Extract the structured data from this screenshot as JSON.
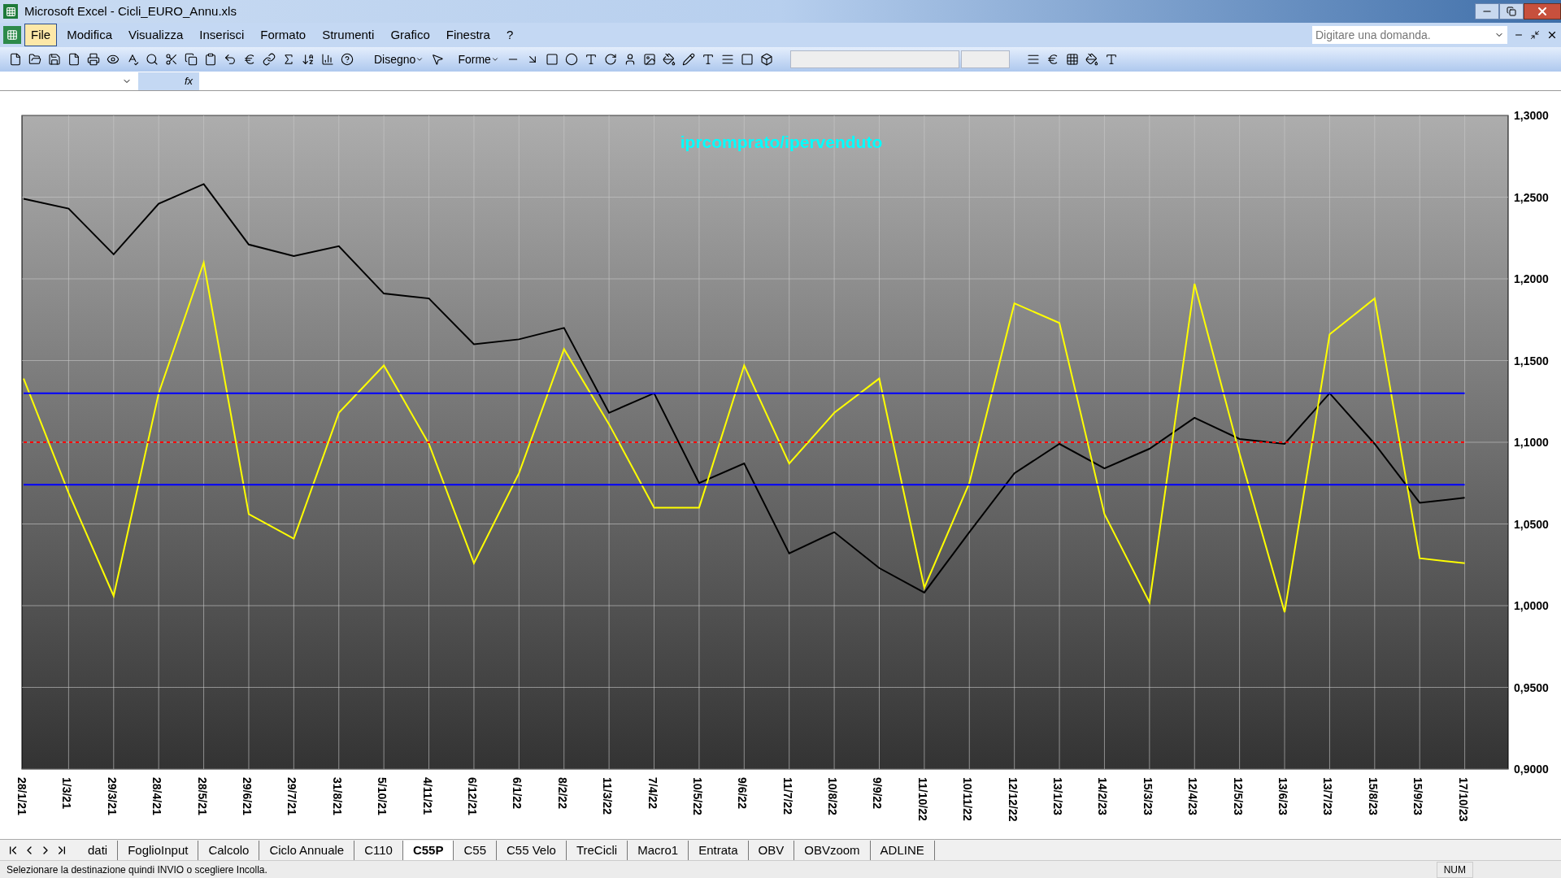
{
  "window": {
    "title": "Microsoft Excel - Cicli_EURO_Annu.xls"
  },
  "menu": [
    {
      "label": "File",
      "selected": true
    },
    {
      "label": "Modifica",
      "selected": false
    },
    {
      "label": "Visualizza",
      "selected": false
    },
    {
      "label": "Inserisci",
      "selected": false
    },
    {
      "label": "Formato",
      "selected": false
    },
    {
      "label": "Strumenti",
      "selected": false
    },
    {
      "label": "Grafico",
      "selected": false
    },
    {
      "label": "Finestra",
      "selected": false
    },
    {
      "label": "?",
      "selected": false
    }
  ],
  "help_search": {
    "placeholder": "Digitare una domanda."
  },
  "toolbar": {
    "drawing_menus": [
      "Disegno",
      "Forme"
    ]
  },
  "formula_bar": {
    "function_label": "fx"
  },
  "chart": {
    "chart_data": {
      "type": "line",
      "title": "iprcomprato/ipervenduto",
      "categories": [
        "28/1/21",
        "1/3/21",
        "29/3/21",
        "28/4/21",
        "28/5/21",
        "29/6/21",
        "29/7/21",
        "31/8/21",
        "5/10/21",
        "4/11/21",
        "6/12/21",
        "6/1/22",
        "8/2/22",
        "11/3/22",
        "7/4/22",
        "10/5/22",
        "9/6/22",
        "11/7/22",
        "10/8/22",
        "9/9/22",
        "11/10/22",
        "10/11/22",
        "12/12/22",
        "13/1/23",
        "14/2/23",
        "15/3/23",
        "12/4/23",
        "12/5/23",
        "13/6/23",
        "13/7/23",
        "15/8/23",
        "15/9/23",
        "17/10/23"
      ],
      "ylim": [
        0.9,
        1.3
      ],
      "grid": true,
      "yticks": [
        {
          "value": 0.9,
          "label": "0,9000"
        },
        {
          "value": 0.95,
          "label": "0,9500"
        },
        {
          "value": 1.0,
          "label": "1,0000"
        },
        {
          "value": 1.05,
          "label": "1,0500"
        },
        {
          "value": 1.1,
          "label": "1,1000"
        },
        {
          "value": 1.15,
          "label": "1,1500"
        },
        {
          "value": 1.2,
          "label": "1,2000"
        },
        {
          "value": 1.25,
          "label": "1,2500"
        },
        {
          "value": 1.3,
          "label": "1,3000"
        }
      ],
      "series": [
        {
          "color": "#000000",
          "line_style": "solid",
          "values": [
            1.249,
            1.243,
            1.215,
            1.246,
            1.258,
            1.221,
            1.214,
            1.22,
            1.191,
            1.188,
            1.16,
            1.163,
            1.17,
            1.118,
            1.13,
            1.075,
            1.087,
            1.032,
            1.045,
            1.023,
            1.008,
            1.045,
            1.081,
            1.099,
            1.084,
            1.096,
            1.115,
            1.102,
            1.099,
            1.13,
            1.099,
            1.063,
            1.066
          ]
        },
        {
          "color": "#ffff00",
          "line_style": "solid",
          "values": [
            1.139,
            1.069,
            1.006,
            1.13,
            1.21,
            1.056,
            1.041,
            1.118,
            1.147,
            1.099,
            1.026,
            1.081,
            1.157,
            1.111,
            1.06,
            1.06,
            1.147,
            1.087,
            1.118,
            1.139,
            1.011,
            1.075,
            1.185,
            1.173,
            1.056,
            1.002,
            1.197,
            1.093,
            0.996,
            1.166,
            1.188,
            1.029,
            1.026
          ]
        },
        {
          "color": "#0000ff",
          "line_style": "solid",
          "values": [
            1.13,
            1.13,
            1.13,
            1.13,
            1.13,
            1.13,
            1.13,
            1.13,
            1.13,
            1.13,
            1.13,
            1.13,
            1.13,
            1.13,
            1.13,
            1.13,
            1.13,
            1.13,
            1.13,
            1.13,
            1.13,
            1.13,
            1.13,
            1.13,
            1.13,
            1.13,
            1.13,
            1.13,
            1.13,
            1.13,
            1.13,
            1.13,
            1.13
          ]
        },
        {
          "color": "#ff0000",
          "line_style": "dashed",
          "values": [
            1.1,
            1.1,
            1.1,
            1.1,
            1.1,
            1.1,
            1.1,
            1.1,
            1.1,
            1.1,
            1.1,
            1.1,
            1.1,
            1.1,
            1.1,
            1.1,
            1.1,
            1.1,
            1.1,
            1.1,
            1.1,
            1.1,
            1.1,
            1.1,
            1.1,
            1.1,
            1.1,
            1.1,
            1.1,
            1.1,
            1.1,
            1.1,
            1.1
          ]
        },
        {
          "color": "#0000ff",
          "line_style": "solid",
          "values": [
            1.074,
            1.074,
            1.074,
            1.074,
            1.074,
            1.074,
            1.074,
            1.074,
            1.074,
            1.074,
            1.074,
            1.074,
            1.074,
            1.074,
            1.074,
            1.074,
            1.074,
            1.074,
            1.074,
            1.074,
            1.074,
            1.074,
            1.074,
            1.074,
            1.074,
            1.074,
            1.074,
            1.074,
            1.074,
            1.074,
            1.074,
            1.074,
            1.074
          ]
        }
      ]
    }
  },
  "sheet_tabs": [
    {
      "label": "dati",
      "selected": false
    },
    {
      "label": "FoglioInput",
      "selected": false
    },
    {
      "label": "Calcolo",
      "selected": false
    },
    {
      "label": "Ciclo Annuale",
      "selected": false
    },
    {
      "label": "C110",
      "selected": false
    },
    {
      "label": "C55P",
      "selected": true
    },
    {
      "label": "C55",
      "selected": false
    },
    {
      "label": "C55 Velo",
      "selected": false
    },
    {
      "label": "TreCicli",
      "selected": false
    },
    {
      "label": "Macro1",
      "selected": false
    },
    {
      "label": "Entrata",
      "selected": false
    },
    {
      "label": "OBV",
      "selected": false
    },
    {
      "label": "OBVzoom",
      "selected": false
    },
    {
      "label": "ADLINE",
      "selected": false
    }
  ],
  "status_bar": {
    "message": "Selezionare la destinazione quindi INVIO o scegliere Incolla.",
    "indicator": "NUM"
  }
}
